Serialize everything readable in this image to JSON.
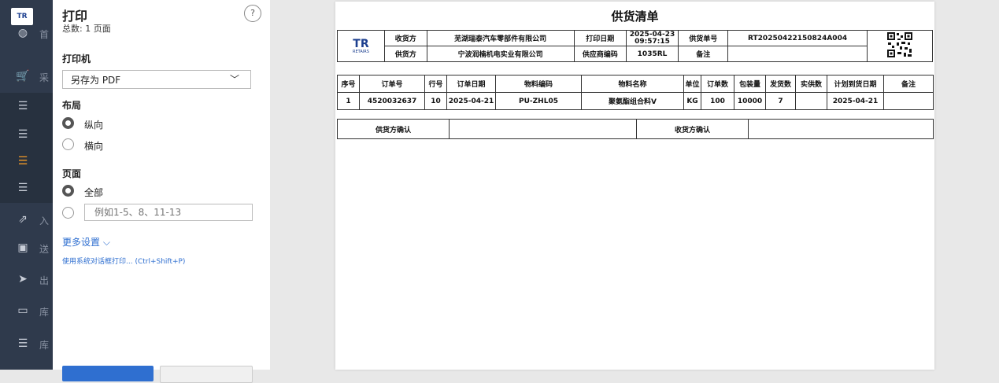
{
  "nav": {
    "logo_text": "TR",
    "items": [
      {
        "icon": "dashboard-icon",
        "glyph": "◍",
        "suffix": "首"
      },
      {
        "icon": "cart-icon",
        "glyph": "🛒",
        "suffix": "采"
      },
      {
        "icon": "list-icon",
        "glyph": "☰",
        "suffix": ""
      },
      {
        "icon": "list-icon",
        "glyph": "☰",
        "suffix": ""
      },
      {
        "icon": "list-icon",
        "glyph": "☰",
        "suffix": ""
      },
      {
        "icon": "list-icon",
        "glyph": "☰",
        "suffix": ""
      },
      {
        "icon": "external-icon",
        "glyph": "⇗",
        "suffix": "入"
      },
      {
        "icon": "scan-icon",
        "glyph": "▣",
        "suffix": "送"
      },
      {
        "icon": "send-icon",
        "glyph": "➤",
        "suffix": "出"
      },
      {
        "icon": "monitor-icon",
        "glyph": "▭",
        "suffix": "库"
      },
      {
        "icon": "menu-icon",
        "glyph": "☰",
        "suffix": "库"
      }
    ],
    "accent": "#f29a27"
  },
  "print_panel": {
    "title": "打印",
    "page_count": "总数: 1 页面",
    "help": "?",
    "printer_label": "打印机",
    "printer_value": "另存为 PDF",
    "layout_label": "布局",
    "layout_portrait": "纵向",
    "layout_landscape": "横向",
    "pages_label": "页面",
    "pages_all": "全部",
    "pages_range_placeholder": "例如1-5、8、11-13",
    "more_settings": "更多设置 ⌵",
    "system_dialog": "使用系统对话框打印... (Ctrl+Shift+P)"
  },
  "document": {
    "title": "供货清单",
    "logo": "TR",
    "logo_sub": "RETAIRS",
    "header": {
      "receiver_label": "收货方",
      "receiver": "芜湖瑞泰汽车零部件有限公司",
      "print_date_label": "打印日期",
      "print_date": "2025-04-23",
      "print_time": "09:57:15",
      "supply_no_label": "供货单号",
      "supply_no": "RT20250422150824A004",
      "supplier_label": "供货方",
      "supplier": "宁波润楠机电实业有限公司",
      "supplier_code_label": "供应商编码",
      "supplier_code": "1035RL",
      "remark_label": "备注",
      "remark": ""
    },
    "columns": [
      "序号",
      "订单号",
      "行号",
      "订单日期",
      "物料编码",
      "物料名称",
      "单位",
      "订单数",
      "包装量",
      "发货数",
      "实供数",
      "计划到货日期",
      "备注"
    ],
    "rows": [
      [
        "1",
        "4520032637",
        "10",
        "2025-04-21",
        "PU-ZHL05",
        "聚氨酯组合料V",
        "KG",
        "100",
        "10000",
        "7",
        "",
        "2025-04-21",
        ""
      ]
    ],
    "supplier_confirm": "供货方确认",
    "receiver_confirm": "收货方确认"
  }
}
